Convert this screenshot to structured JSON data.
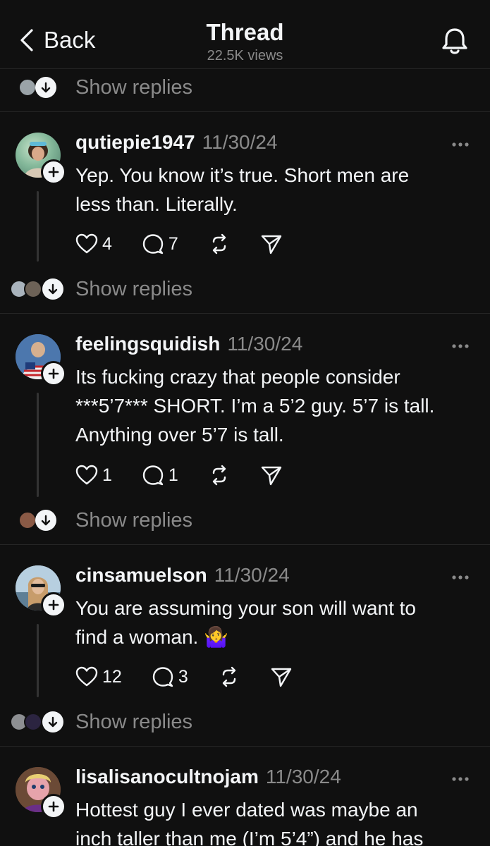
{
  "header": {
    "back_label": "Back",
    "title": "Thread",
    "views": "22.5K views"
  },
  "show_replies_label": "Show replies",
  "posts": [
    {
      "username": "qutiepie1947",
      "date": "11/30/24",
      "lines": [
        "Yep. You know it’s true. Short men are",
        "less than. Literally."
      ],
      "likes": "4",
      "comments": "7"
    },
    {
      "username": "feelingsquidish",
      "date": "11/30/24",
      "lines": [
        "Its fucking crazy that people consider",
        "***5’7*** SHORT. I’m a 5’2 guy. 5’7 is tall.",
        "Anything over 5’7 is tall."
      ],
      "likes": "1",
      "comments": "1"
    },
    {
      "username": "cinsamuelson",
      "date": "11/30/24",
      "lines": [
        "You are assuming your son will want to",
        "find a woman. 🤷‍♀️"
      ],
      "likes": "12",
      "comments": "3"
    },
    {
      "username": "lisalisanocultnojam",
      "date": "11/30/24",
      "lines": [
        "Hottest guy I ever dated was maybe an",
        "inch taller than me (I’m 5’4”) and he has"
      ]
    }
  ],
  "colors": {
    "background": "#101010",
    "text": "#f3f5f7",
    "secondary": "#8a8a8a",
    "divider": "#262626"
  }
}
